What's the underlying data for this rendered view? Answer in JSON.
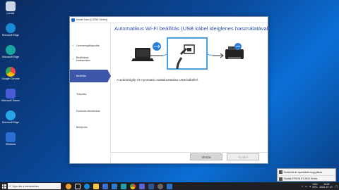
{
  "desktop": {
    "icons": [
      {
        "label": "Lomtár",
        "color": "#c8d6e8"
      },
      {
        "label": "Microsoft Edge",
        "color": "#1b8ad6"
      },
      {
        "label": "Microsoft Edge",
        "color": "#1aa5a0"
      },
      {
        "label": "Google Chrome",
        "color": "#e44"
      },
      {
        "label": "Microsoft Teams",
        "color": "#4a5bd6"
      },
      {
        "label": "Microsoft Edge",
        "color": "#29a3e4"
      },
      {
        "label": "Windows",
        "color": "#2c6fd1"
      }
    ]
  },
  "installer": {
    "window_title": "Install Navi [L3250 Series]",
    "steps": [
      {
        "label": "Licencmegállapodás",
        "done": true
      },
      {
        "label": "Beállítások kiválasztása",
        "done": true
      },
      {
        "label": "Beállítás",
        "done": false,
        "active": true
      },
      {
        "label": "Telepítés",
        "done": false
      },
      {
        "label": "Funkciók ellenőrzése",
        "done": false
      },
      {
        "label": "Befejezés",
        "done": false
      }
    ],
    "title": "Automatikus Wi-Fi beállítás (USB kábel ideiglenes használatával)",
    "instruction": "A számítógép és nyomtató csatlakoztatása USB-kábellel.",
    "buttons": {
      "back": "Vissza",
      "next": "Tovább"
    },
    "accent": "#3c57a8"
  },
  "notification": {
    "items": [
      {
        "label": "Eszközök és nyomtatók megnyitása"
      },
      {
        "label": "Kiadás EPSON ET-2810 Series"
      }
    ]
  },
  "taskbar": {
    "search_placeholder": "Írjon ide a kereséshez",
    "tray": {
      "lang": "HUN",
      "layout": "INTL",
      "time": "16:45",
      "date": "2023. 07. 07."
    }
  }
}
